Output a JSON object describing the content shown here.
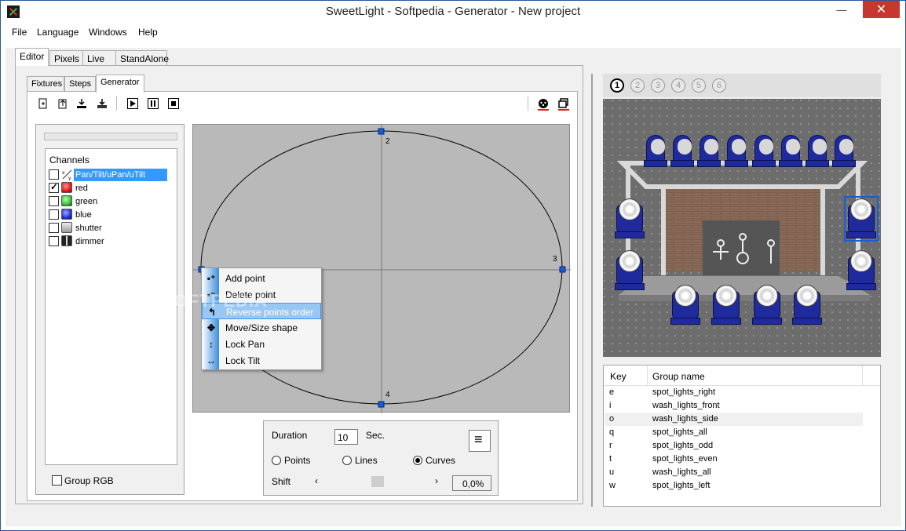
{
  "window": {
    "title": "SweetLight - Softpedia - Generator - New project"
  },
  "menu": [
    "File",
    "Language",
    "Windows",
    "Help"
  ],
  "main_tabs": [
    "Editor",
    "Pixels",
    "Live",
    "StandAlone"
  ],
  "sub_tabs": [
    "Fixtures",
    "Steps",
    "Generator"
  ],
  "channels": {
    "title": "Channels",
    "items": [
      {
        "label": "Pan/Tilt/uPan/uTilt",
        "checked": false,
        "color": "#ffffff"
      },
      {
        "label": "red",
        "checked": true,
        "color": "#e41a1c"
      },
      {
        "label": "green",
        "checked": false,
        "color": "#3cc13c"
      },
      {
        "label": "blue",
        "checked": false,
        "color": "#2233dd"
      },
      {
        "label": "shutter",
        "checked": false,
        "color": "#cfcfcf"
      },
      {
        "label": "dimmer",
        "checked": false,
        "color": "#444444"
      }
    ],
    "group_rgb": "Group RGB"
  },
  "canvas": {
    "point_labels": [
      "2",
      "3",
      "4"
    ]
  },
  "context_menu": [
    {
      "label": "Add point",
      "icon": "add-point-icon",
      "highlighted": false
    },
    {
      "label": "Delete point",
      "icon": "delete-point-icon",
      "highlighted": false
    },
    {
      "label": "Reverse points order",
      "icon": "reverse-icon",
      "highlighted": true
    },
    {
      "label": "Move/Size shape",
      "icon": "move-icon",
      "highlighted": false
    },
    {
      "label": "Lock Pan",
      "icon": "lock-pan-icon",
      "highlighted": false
    },
    {
      "label": "Lock Tilt",
      "icon": "lock-tilt-icon",
      "highlighted": false
    }
  ],
  "controls": {
    "duration_label": "Duration",
    "duration_value": "10",
    "duration_unit": "Sec.",
    "modes": [
      "Points",
      "Lines",
      "Curves"
    ],
    "selected_mode": "Curves",
    "shift_label": "Shift",
    "shift_value": "0,0%"
  },
  "scene_tabs": [
    "1",
    "2",
    "3",
    "4",
    "5",
    "6"
  ],
  "groups": {
    "headers": [
      "Key",
      "Group name"
    ],
    "rows": [
      {
        "key": "e",
        "name": "spot_lights_right"
      },
      {
        "key": "i",
        "name": "wash_lights_front"
      },
      {
        "key": "o",
        "name": "wash_lights_side"
      },
      {
        "key": "q",
        "name": "spot_lights_all"
      },
      {
        "key": "r",
        "name": "spot_lights_odd"
      },
      {
        "key": "t",
        "name": "spot_lights_even"
      },
      {
        "key": "u",
        "name": "wash_lights_all"
      },
      {
        "key": "w",
        "name": "spot_lights_left"
      }
    ]
  },
  "watermark": "SOFTPEDIA"
}
